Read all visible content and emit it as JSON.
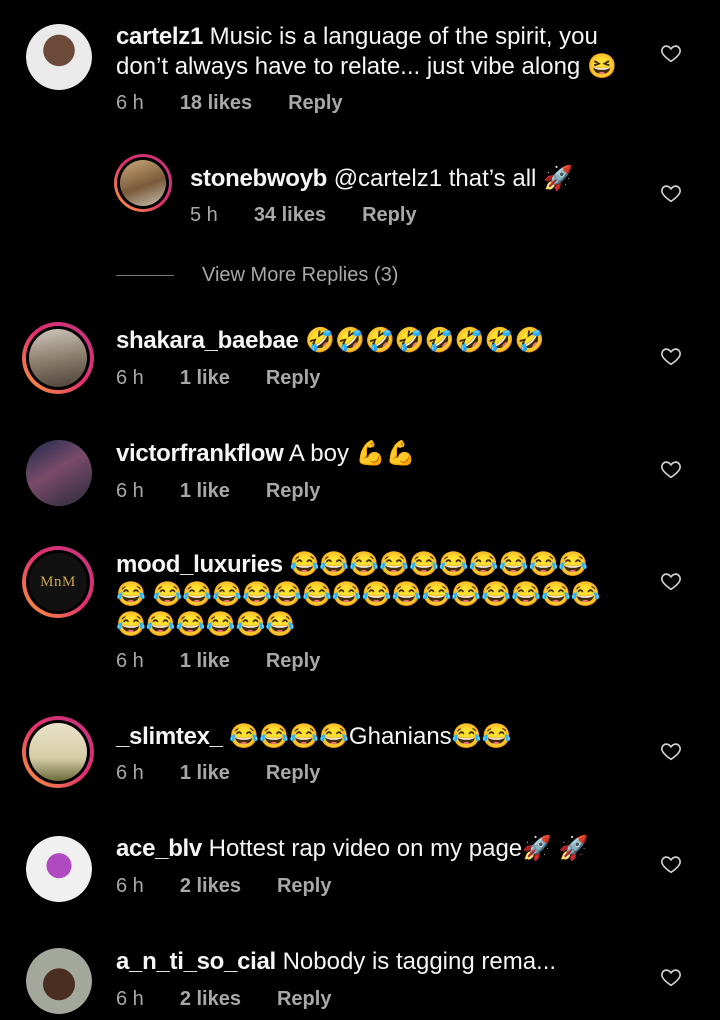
{
  "actions": {
    "reply_label": "Reply"
  },
  "comments": [
    {
      "username": "cartelz1",
      "text": "Music is a language of the spirit, you don’t always have to relate... just vibe along 😆",
      "time": "6 h",
      "likes": "18 likes"
    },
    {
      "username": "stonebwoyb",
      "text": "@cartelz1 that’s all 🚀",
      "time": "5 h",
      "likes": "34 likes"
    },
    {
      "username": "shakara_baebae",
      "text": "🤣🤣🤣🤣🤣🤣🤣🤣",
      "time": "6 h",
      "likes": "1 like"
    },
    {
      "username": "victorfrankflow",
      "text": "A boy 💪💪",
      "time": "6 h",
      "likes": "1 like"
    },
    {
      "username": "mood_luxuries",
      "text": "😂😂😂😂😂😂😂😂😂😂😂 😂😂😂😂😂😂😂😂😂😂😂😂😂😂😂😂😂😂😂😂😂",
      "time": "6 h",
      "likes": "1 like",
      "avatar_text": "MnM"
    },
    {
      "username": "_slimtex_",
      "text": "😂😂😂😂Ghanians😂😂",
      "time": "6 h",
      "likes": "1 like"
    },
    {
      "username": "ace_blv",
      "text": "Hottest rap video on my page🚀 🚀",
      "time": "6 h",
      "likes": "2 likes"
    },
    {
      "username": "a_n_ti_so_cial",
      "text": "Nobody is tagging rema...",
      "time": "6 h",
      "likes": "2 likes"
    }
  ],
  "view_more_replies": "View More Replies (3)",
  "icons": {
    "like": "heart-outline-icon"
  },
  "colors": {
    "background": "#000000",
    "primary_text": "#f5f5f5",
    "secondary_text": "#a8a8a8",
    "story_ring_start": "#f9a23c",
    "story_ring_end": "#c13584"
  }
}
